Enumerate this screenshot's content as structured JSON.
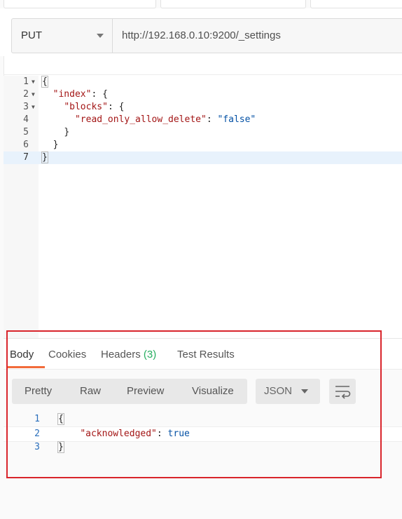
{
  "request": {
    "method": "PUT",
    "url": "http://192.168.0.10:9200/_settings"
  },
  "editor": {
    "lines": [
      {
        "num": "1",
        "fold": true
      },
      {
        "num": "2",
        "fold": true
      },
      {
        "num": "3",
        "fold": true
      },
      {
        "num": "4",
        "fold": false
      },
      {
        "num": "5",
        "fold": false
      },
      {
        "num": "6",
        "fold": false
      },
      {
        "num": "7",
        "fold": false
      }
    ],
    "code": {
      "l1_open": "{",
      "l2_key": "\"index\"",
      "l2_rest": ": {",
      "l3_key": "\"blocks\"",
      "l3_rest": ": {",
      "l4_key": "\"read_only_allow_delete\"",
      "l4_colon": ": ",
      "l4_val": "\"false\"",
      "l5": "}",
      "l6": "}",
      "l7": "}"
    }
  },
  "response": {
    "tabs": {
      "body": "Body",
      "cookies": "Cookies",
      "headers": "Headers",
      "headers_count": "(3)",
      "test_results": "Test Results"
    },
    "view_modes": {
      "pretty": "Pretty",
      "raw": "Raw",
      "preview": "Preview",
      "visualize": "Visualize"
    },
    "format": "JSON",
    "lines": {
      "n1": "1",
      "n2": "2",
      "n3": "3",
      "l1": "{",
      "l2_key": "\"acknowledged\"",
      "l2_colon": ": ",
      "l2_val": "true",
      "l3": "}"
    }
  },
  "colors": {
    "active_tab_underline": "#f26b3a",
    "highlight_box": "#d9252c",
    "headers_count": "#27ae60"
  },
  "icons": [
    "chevron-down-icon",
    "fold-arrow-icon",
    "wrap-lines-icon"
  ]
}
